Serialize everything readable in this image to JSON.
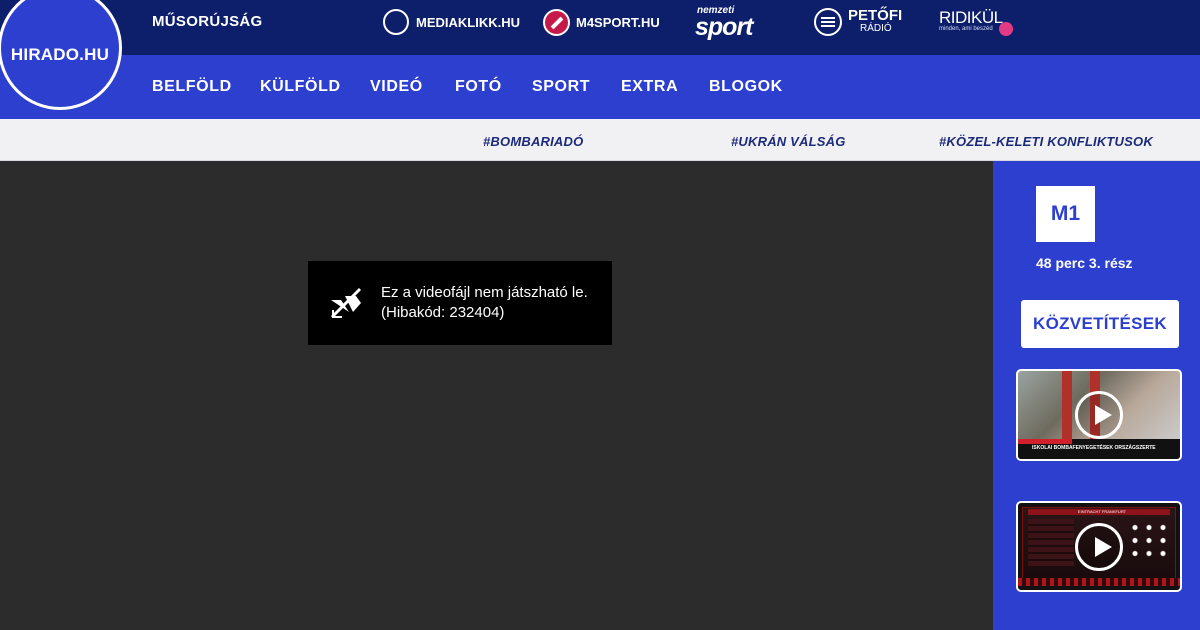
{
  "header": {
    "logo": "HIRADO.HU",
    "tv_guide": "MŰSORÚJSÁG",
    "partners": {
      "mediaklikk": "MEDIAKLIKK.HU",
      "m4sport": "M4SPORT.HU",
      "nemzeti_small": "nemzeti",
      "nemzeti_big": "sport",
      "petofi_name": "PETŐFI",
      "petofi_sub": "RÁDIÓ",
      "ridikul_name": "RIDIKÜL",
      "ridikul_tagline": "minden, ami beszéd"
    }
  },
  "nav": {
    "items": [
      "BELFÖLD",
      "KÜLFÖLD",
      "VIDEÓ",
      "FOTÓ",
      "SPORT",
      "EXTRA",
      "BLOGOK"
    ]
  },
  "tags": [
    "#BOMBARIADÓ",
    "#UKRÁN VÁLSÁG",
    "#KÖZEL-KELETI KONFLIKTUSOK"
  ],
  "player": {
    "error_line1": "Ez a videofájl nem játszható le.",
    "error_line2": "(Hibakód: 232404)",
    "error_icon": "video-off-icon"
  },
  "side": {
    "channel": "M1",
    "program": "48 perc 3. rész",
    "broadcasts_button": "KÖZVETÍTÉSEK",
    "thumb1_caption": "ISKOLAI BOMBAFENYEGETÉSEK ORSZÁGSZERTE",
    "thumb2_caption": "EINTRACHT FRANKFURT"
  },
  "colors": {
    "top_bar": "#0d1f6b",
    "nav_blue": "#2c3fcf",
    "tag_text": "#1b2a7a",
    "player_bg": "#2c2c2c"
  }
}
